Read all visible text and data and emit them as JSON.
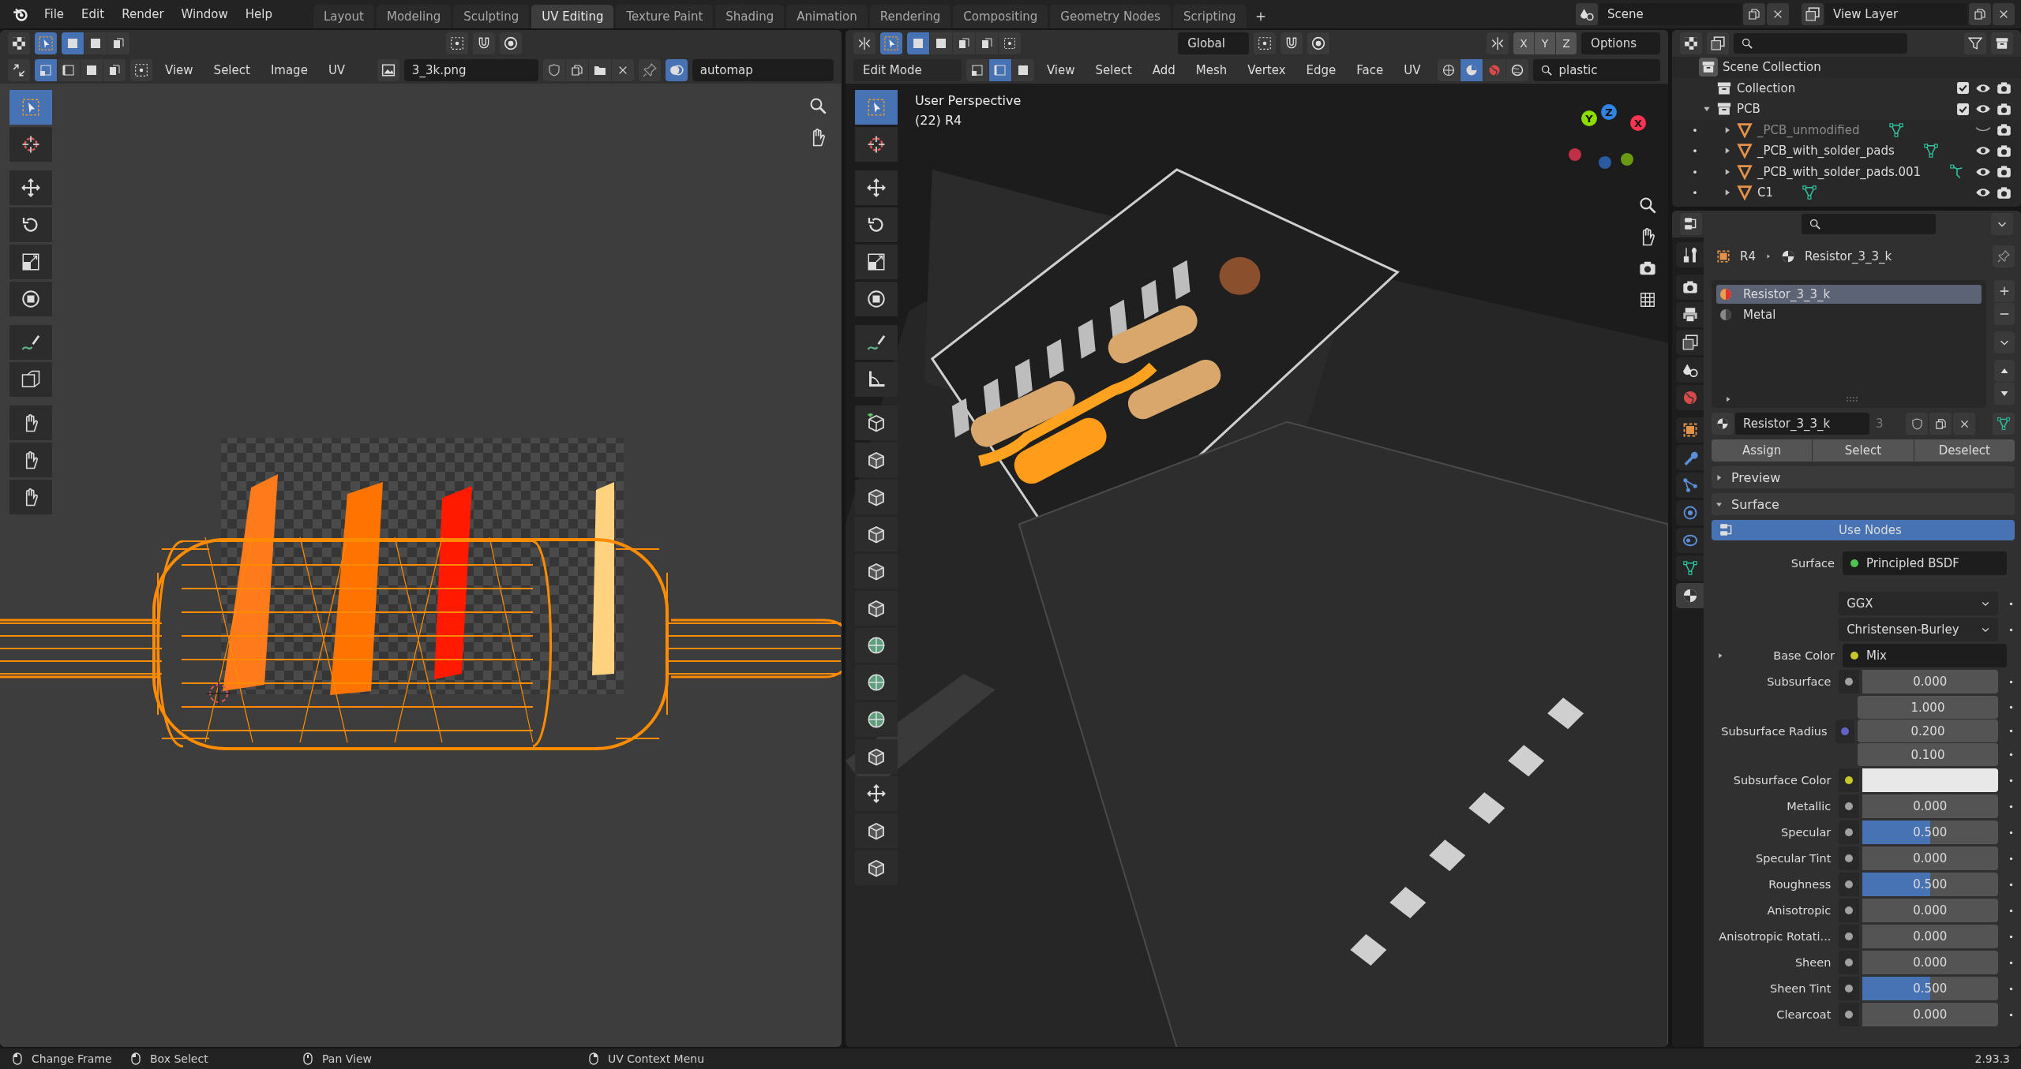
{
  "menu": [
    "File",
    "Edit",
    "Render",
    "Window",
    "Help"
  ],
  "workspaces": [
    {
      "label": "Layout",
      "selected": false
    },
    {
      "label": "Modeling",
      "selected": false
    },
    {
      "label": "Sculpting",
      "selected": false
    },
    {
      "label": "UV Editing",
      "selected": true
    },
    {
      "label": "Texture Paint",
      "selected": false
    },
    {
      "label": "Shading",
      "selected": false
    },
    {
      "label": "Animation",
      "selected": false
    },
    {
      "label": "Rendering",
      "selected": false
    },
    {
      "label": "Compositing",
      "selected": false
    },
    {
      "label": "Geometry Nodes",
      "selected": false
    },
    {
      "label": "Scripting",
      "selected": false
    }
  ],
  "scene": "Scene",
  "view_layer": "View Layer",
  "uv_editor": {
    "menu": [
      "View",
      "Select",
      "Image",
      "UV"
    ],
    "image_name": "3_3k.png",
    "uv_map": "automap",
    "select_modes": [
      {
        "kind": "vertex",
        "selected": true
      },
      {
        "kind": "edge",
        "selected": false
      },
      {
        "kind": "face",
        "selected": false
      },
      {
        "kind": "island",
        "selected": false
      }
    ],
    "tools": [
      {
        "kind": "select",
        "selected": true
      },
      {
        "kind": "cursor",
        "selected": false
      },
      {
        "kind": "move",
        "selected": false
      },
      {
        "kind": "rotate",
        "selected": false
      },
      {
        "kind": "scale",
        "selected": false
      },
      {
        "kind": "transform",
        "selected": false
      },
      {
        "kind": "annotate",
        "selected": false
      },
      {
        "kind": "box",
        "selected": false
      },
      {
        "kind": "hand",
        "selected": false
      },
      {
        "kind": "hand",
        "selected": false
      },
      {
        "kind": "hand",
        "selected": false
      }
    ]
  },
  "viewport": {
    "mode": "Edit Mode",
    "orientation": "Global",
    "mirror_axes": [
      "X",
      "Y",
      "Z"
    ],
    "options": "Options",
    "menu": [
      "View",
      "Select",
      "Add",
      "Mesh",
      "Vertex",
      "Edge",
      "Face",
      "UV"
    ],
    "search": "plastic",
    "select_modes": [
      {
        "kind": "vertex",
        "selected": false
      },
      {
        "kind": "edge",
        "selected": true
      },
      {
        "kind": "face",
        "selected": false
      }
    ],
    "shading": [
      {
        "kind": "wireframe",
        "selected": false
      },
      {
        "kind": "solid",
        "selected": true
      },
      {
        "kind": "material",
        "selected": false
      },
      {
        "kind": "rendered",
        "selected": false
      }
    ],
    "overlay_lines": [
      "User Perspective",
      "(22) R4"
    ],
    "gizmo_axes": [
      {
        "label": "Y",
        "color": "#8bdc00"
      },
      {
        "label": "Z",
        "color": "#2f83e3"
      },
      {
        "label": "X",
        "color": "#ff3352"
      }
    ],
    "tools": [
      {
        "kind": "select",
        "selected": true
      },
      {
        "kind": "cursor",
        "selected": false
      },
      {
        "kind": "move",
        "selected": false
      },
      {
        "kind": "rotate",
        "selected": false
      },
      {
        "kind": "scale",
        "selected": false
      },
      {
        "kind": "transform",
        "selected": false
      },
      {
        "kind": "annotate",
        "selected": false
      },
      {
        "kind": "measure",
        "selected": false
      },
      {
        "kind": "cube_add",
        "selected": false
      },
      {
        "kind": "cube",
        "selected": false
      },
      {
        "kind": "cube",
        "selected": false
      },
      {
        "kind": "cube",
        "selected": false
      },
      {
        "kind": "cube",
        "selected": false
      },
      {
        "kind": "cube",
        "selected": false
      },
      {
        "kind": "sphere",
        "selected": false
      },
      {
        "kind": "sphere",
        "selected": false
      },
      {
        "kind": "sphere",
        "selected": false
      },
      {
        "kind": "cube",
        "selected": false
      },
      {
        "kind": "move",
        "selected": false
      },
      {
        "kind": "cube",
        "selected": false
      },
      {
        "kind": "cube",
        "selected": false
      }
    ]
  },
  "outliner": {
    "items": [
      {
        "kind": "scene_collection",
        "label": "Scene Collection",
        "children": [
          {
            "kind": "collection",
            "label": "Collection",
            "checked": true,
            "visible": true
          },
          {
            "kind": "collection",
            "label": "PCB",
            "checked": true,
            "visible": true,
            "expanded": true,
            "children": [
              {
                "kind": "mesh",
                "label": "_PCB_unmodified",
                "visible": false,
                "data_icon": {
                  "kind": "mesh"
                }
              },
              {
                "kind": "mesh",
                "label": "_PCB_with_solder_pads",
                "visible": true,
                "data_icon": {
                  "kind": "mesh"
                }
              },
              {
                "kind": "mesh",
                "label": "_PCB_with_solder_pads.001",
                "visible": true,
                "data_icon": {
                  "kind": "hook"
                }
              },
              {
                "kind": "mesh",
                "label": "C1",
                "visible": true,
                "data_icon": {
                  "kind": "mesh"
                }
              }
            ]
          }
        ]
      }
    ]
  },
  "properties": {
    "tabs": [
      {
        "kind": "tool",
        "selected": false
      },
      {
        "kind": "render",
        "selected": false
      },
      {
        "kind": "output",
        "selected": false
      },
      {
        "kind": "view_layer",
        "selected": false
      },
      {
        "kind": "scene",
        "selected": false
      },
      {
        "kind": "world",
        "selected": false
      },
      {
        "kind": "object",
        "selected": false
      },
      {
        "kind": "modifiers",
        "selected": false
      },
      {
        "kind": "particles",
        "selected": false
      },
      {
        "kind": "physics",
        "selected": false
      },
      {
        "kind": "constraints",
        "selected": false
      },
      {
        "kind": "data",
        "selected": false
      },
      {
        "kind": "material",
        "selected": true
      }
    ],
    "object": "R4",
    "material": "Resistor_3_3_k",
    "slots": [
      {
        "label": "Resistor_3_3_k",
        "selected": true
      },
      {
        "label": "Metal",
        "selected": false
      }
    ],
    "material_field": "Resistor_3_3_k",
    "users": "3",
    "buttons": [
      "Assign",
      "Select",
      "Deselect"
    ],
    "panels": [
      {
        "label": "Preview",
        "expanded": false
      },
      {
        "label": "Surface",
        "expanded": true
      }
    ],
    "use_nodes": "Use Nodes",
    "rows": [
      {
        "kind": "link",
        "label": "Surface",
        "value": "Principled BSDF",
        "socket": {
          "color": "#4fc44f"
        }
      },
      {
        "kind": "dropdown",
        "value": "GGX"
      },
      {
        "kind": "dropdown",
        "value": "Christensen-Burley"
      },
      {
        "kind": "link",
        "label": "Base Color",
        "value": "Mix",
        "socket": {
          "color": "#c7c729"
        },
        "expandable": true
      },
      {
        "kind": "slider",
        "label": "Subsurface",
        "value": "0.000",
        "socket": {
          "color": "#a1a1a1"
        }
      },
      {
        "kind": "vector",
        "label": "Subsurface Radius",
        "values": [
          "1.000",
          "0.200",
          "0.100"
        ],
        "socket": {
          "color": "#6363c7"
        }
      },
      {
        "kind": "swatch",
        "label": "Subsurface Color",
        "color": "#e8e8e8",
        "socket": {
          "color": "#c7c729"
        }
      },
      {
        "kind": "slider",
        "label": "Metallic",
        "value": "0.000",
        "socket": {
          "color": "#a1a1a1"
        }
      },
      {
        "kind": "slider",
        "label": "Specular",
        "value": "0.500",
        "level": 0.5,
        "socket": {
          "color": "#a1a1a1"
        }
      },
      {
        "kind": "slider",
        "label": "Specular Tint",
        "value": "0.000",
        "socket": {
          "color": "#a1a1a1"
        }
      },
      {
        "kind": "slider",
        "label": "Roughness",
        "value": "0.500",
        "level": 0.5,
        "socket": {
          "color": "#a1a1a1"
        }
      },
      {
        "kind": "slider",
        "label": "Anisotropic",
        "value": "0.000",
        "socket": {
          "color": "#a1a1a1"
        }
      },
      {
        "kind": "slider",
        "label": "Anisotropic Rotati...",
        "value": "0.000",
        "socket": {
          "color": "#a1a1a1"
        }
      },
      {
        "kind": "slider",
        "label": "Sheen",
        "value": "0.000",
        "socket": {
          "color": "#a1a1a1"
        }
      },
      {
        "kind": "slider",
        "label": "Sheen Tint",
        "value": "0.500",
        "level": 0.5,
        "socket": {
          "color": "#a1a1a1"
        }
      },
      {
        "kind": "slider",
        "label": "Clearcoat",
        "value": "0.000",
        "socket": {
          "color": "#a1a1a1"
        }
      }
    ]
  },
  "status_bar": [
    {
      "kind": "mouse_left",
      "label": "Change Frame"
    },
    {
      "kind": "mouse_drag",
      "label": "Box Select"
    },
    {
      "kind": "mouse_middle",
      "label": "Pan View"
    },
    {
      "kind": "mouse_right",
      "label": "UV Context Menu"
    }
  ],
  "version": "2.93.3"
}
